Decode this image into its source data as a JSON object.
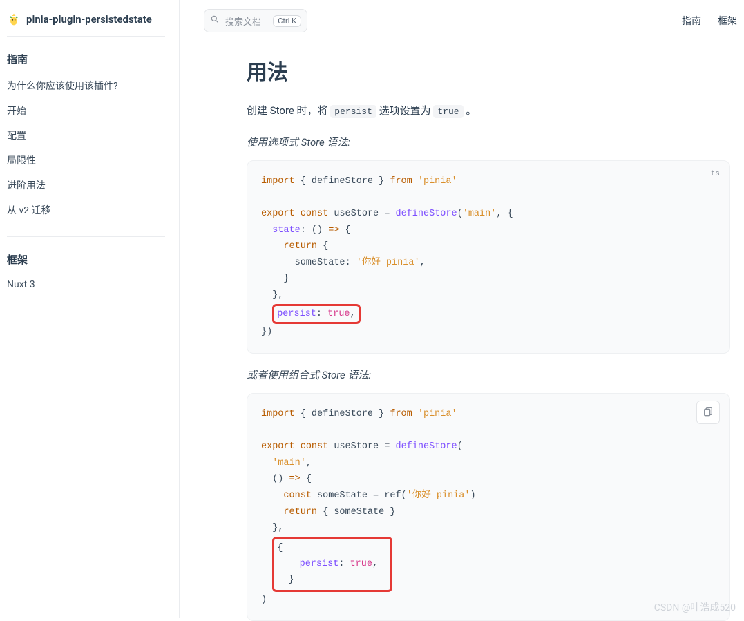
{
  "brand": {
    "title": "pinia-plugin-persistedstate"
  },
  "search": {
    "placeholder": "搜索文档",
    "shortcut": "Ctrl K"
  },
  "topnav": {
    "a": "指南",
    "b": "框架"
  },
  "sidebar": {
    "group1": {
      "head": "指南",
      "items": [
        "为什么你应该使用该插件?",
        "开始",
        "配置",
        "局限性",
        "进阶用法",
        "从 v2 迁移"
      ]
    },
    "group2": {
      "head": "框架",
      "items": [
        "Nuxt 3"
      ]
    }
  },
  "content": {
    "title": "用法",
    "para_pre": "创建 Store 时，将 ",
    "para_code1": "persist",
    "para_mid": " 选项设置为 ",
    "para_code2": "true",
    "para_post": " 。",
    "sub1": "使用选项式 Store 语法:",
    "sub2": "或者使用组合式 Store 语法:",
    "lang": "ts"
  },
  "code1": {
    "l1a": "import",
    "l1b": "{ defineStore }",
    "l1c": "from",
    "l1d": "'pinia'",
    "l3a": "export",
    "l3b": "const",
    "l3c": "useStore",
    "l3d": "=",
    "l3e": "defineStore",
    "l3f": "(",
    "l3g": "'main'",
    "l3h": ", {",
    "l4a": "state",
    "l4b": ": () ",
    "l4c": "=>",
    "l4d": " {",
    "l5": "return",
    "l5b": " {",
    "l6a": "someState: ",
    "l6b": "'你好 pinia'",
    "l6c": ",",
    "l7": "}",
    "l8": "},",
    "l9a": "persist",
    "l9b": ": ",
    "l9c": "true",
    "l9d": ",",
    "l10": "})"
  },
  "code2": {
    "l1a": "import",
    "l1b": "{ defineStore }",
    "l1c": "from",
    "l1d": "'pinia'",
    "l3a": "export",
    "l3b": "const",
    "l3c": "useStore",
    "l3d": "=",
    "l3e": "defineStore",
    "l3f": "(",
    "l4": "'main'",
    "l4b": ",",
    "l5a": "() ",
    "l5b": "=>",
    "l5c": " {",
    "l6a": "const",
    "l6b": " someState ",
    "l6c": "=",
    "l6d": " ref(",
    "l6e": "'你好 pinia'",
    "l6f": ")",
    "l7a": "return",
    "l7b": " { someState }",
    "l8": "},",
    "l9o": "{",
    "l10a": "persist",
    "l10b": ": ",
    "l10c": "true",
    "l10d": ",",
    "l11c": "}",
    "l12": ")"
  },
  "watermark": "CSDN @叶浩成520"
}
